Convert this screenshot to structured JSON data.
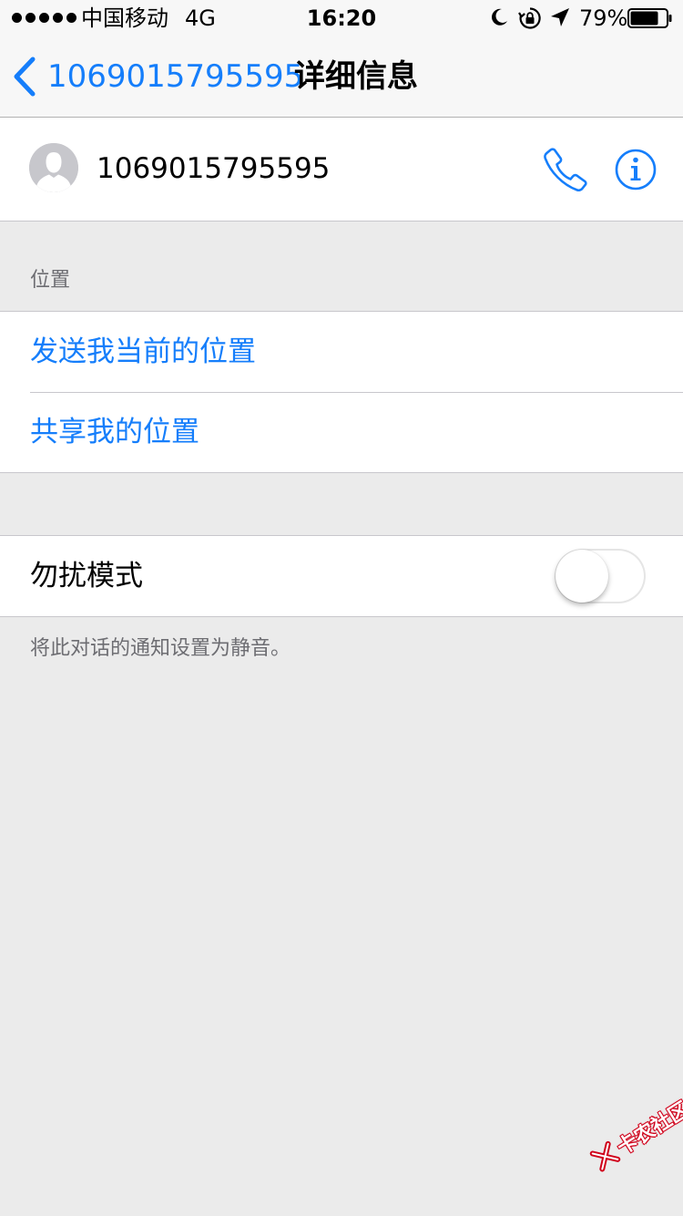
{
  "status_bar": {
    "carrier": "中国移动",
    "network": "4G",
    "time": "16:20",
    "battery_percent": "79%",
    "battery_level": 0.79,
    "icons": [
      "moon-icon",
      "lock-rotation-icon",
      "location-arrow-icon",
      "battery-icon"
    ]
  },
  "nav": {
    "back_label": "1069015795595",
    "title": "详细信息"
  },
  "contact": {
    "name": "1069015795595",
    "icons": [
      "avatar-icon",
      "phone-icon",
      "info-icon"
    ]
  },
  "location_section": {
    "header": "位置",
    "items": [
      {
        "label": "发送我当前的位置"
      },
      {
        "label": "共享我的位置"
      }
    ]
  },
  "dnd": {
    "label": "勿扰模式",
    "enabled": false,
    "footer": "将此对话的通知设置为静音。"
  },
  "watermark": {
    "text": "卡农社区"
  },
  "colors": {
    "accent": "#157efb",
    "background": "#ebebeb",
    "cell_background": "#ffffff",
    "secondary_text": "#6d6d72",
    "separator": "#c8c7cc"
  }
}
